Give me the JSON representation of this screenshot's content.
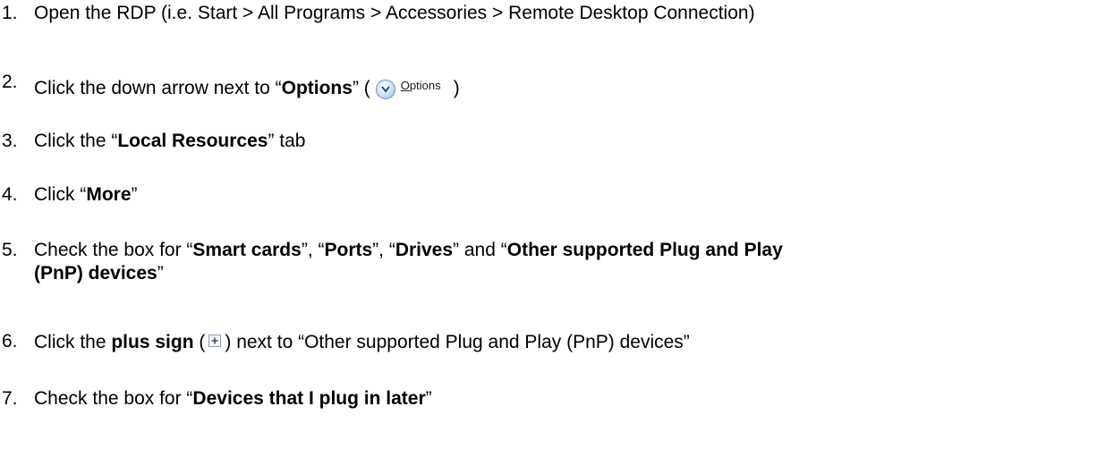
{
  "steps": [
    {
      "num": "1.",
      "text": "Open the RDP (i.e. Start > All Programs > Accessories > Remote Desktop Connection)"
    },
    {
      "num": "2.",
      "pre": "Click the down arrow next to “",
      "bold": "Options",
      "mid": "” (",
      "post": ")",
      "button": {
        "icon": "chevron-down-icon",
        "label_underlined": "O",
        "label_rest": "ptions"
      }
    },
    {
      "num": "3.",
      "pre": "Click the “",
      "bold": "Local Resources",
      "post": "” tab"
    },
    {
      "num": "4.",
      "pre": "Click “",
      "bold": "More",
      "post": "”"
    },
    {
      "num": "5.",
      "pre": "Check the box for “",
      "bold1": "Smart cards",
      "sep1": "”, “",
      "bold2": "Ports",
      "sep2": "”, “",
      "bold3": "Drives",
      "sep3": "” and “",
      "bold4_line1": "Other supported Plug and Play",
      "bold4_line2": "(PnP) devices",
      "post": "”"
    },
    {
      "num": "6.",
      "pre": "Click the ",
      "bold": "plus sign",
      "mid": " (",
      "post": ") next to “Other supported Plug and Play (PnP) devices”",
      "icon": "plus-box-icon"
    },
    {
      "num": "7.",
      "pre": "Check the box for “",
      "bold": "Devices that I plug in later",
      "post": "”"
    }
  ]
}
